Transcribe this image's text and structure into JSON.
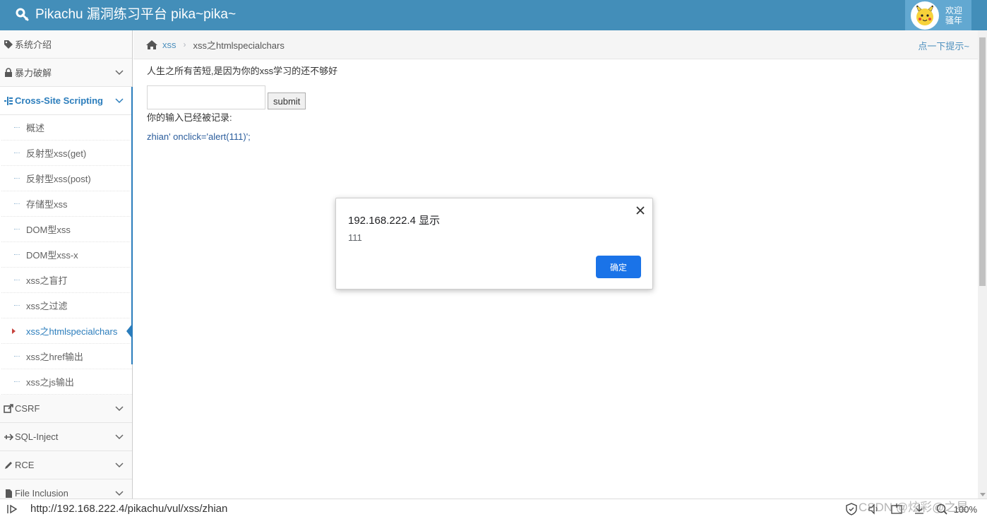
{
  "navbar": {
    "brand": "Pikachu 漏洞练习平台 pika~pika~",
    "welcome_line1": "欢迎",
    "welcome_line2": "骚年"
  },
  "sidebar": {
    "items": [
      {
        "label": "系统介绍",
        "icon": "tag-icon"
      },
      {
        "label": "暴力破解",
        "icon": "lock-icon"
      },
      {
        "label": "Cross-Site Scripting",
        "icon": "list-tree-icon"
      }
    ],
    "xss_submenu": [
      "概述",
      "反射型xss(get)",
      "反射型xss(post)",
      "存储型xss",
      "DOM型xss",
      "DOM型xss-x",
      "xss之盲打",
      "xss之过滤",
      "xss之htmlspecialchars",
      "xss之href输出",
      "xss之js输出"
    ],
    "bottom_items": [
      {
        "label": "CSRF",
        "icon": "share-icon"
      },
      {
        "label": "SQL-Inject",
        "icon": "plane-icon"
      },
      {
        "label": "RCE",
        "icon": "pencil-icon"
      },
      {
        "label": "File Inclusion",
        "icon": "file-icon"
      }
    ]
  },
  "breadcrumb": {
    "parent": "xss",
    "current": "xss之htmlspecialchars",
    "hint": "点一下提示~"
  },
  "content": {
    "tagline": "人生之所有苦短,是因为你的xss学习的还不够好",
    "input_value": "",
    "submit_label": "submit",
    "record_label": "你的输入已经被记录:",
    "record_value": "zhian' onclick='alert(111)';"
  },
  "dialog": {
    "title": "192.168.222.4 显示",
    "message": "111",
    "ok_label": "确定"
  },
  "statusbar": {
    "url": "http://192.168.222.4/pikachu/vul/xss/zhian",
    "zoom": "100%"
  },
  "watermark": "CSDN @炫彩@之星",
  "colors": {
    "navbar": "#438eb9",
    "accent": "#2b7dbc",
    "dialog_button": "#1a73e8"
  }
}
